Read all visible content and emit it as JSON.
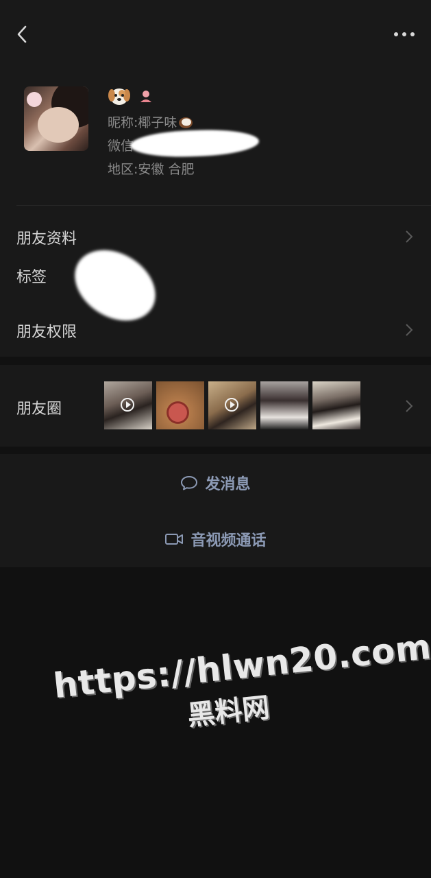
{
  "profile": {
    "nickname_line": "昵称:椰子味",
    "wechat_line": "微信",
    "region_line": "地区:安徽 合肥"
  },
  "menu": {
    "friend_profile": "朋友资料",
    "tags": "标签",
    "friend_permissions": "朋友权限"
  },
  "moments": {
    "label": "朋友圈"
  },
  "actions": {
    "send_message": "发消息",
    "video_call": "音视频通话"
  },
  "watermark": {
    "url": "https://hlwn20.com",
    "name": "黑料网"
  },
  "colors": {
    "background": "#111111",
    "panel": "#191919",
    "action_text": "#8c9ab5"
  }
}
